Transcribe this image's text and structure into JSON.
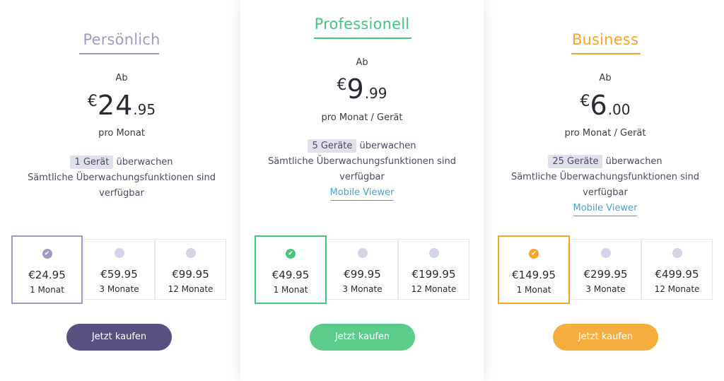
{
  "plans": [
    {
      "name": "Persönlich",
      "color": "#9b9bc4",
      "from_label": "Ab",
      "currency": "€",
      "price_int": "24",
      "price_dec": ".95",
      "per_label": "pro Monat",
      "devices_badge": "1 Gerät",
      "monitor_text": "überwachen",
      "features_text": "Sämtliche Überwachungsfunktionen sind verfügbar",
      "options": [
        {
          "price": "€24.95",
          "duration": "1 Monat",
          "selected": true
        },
        {
          "price": "€59.95",
          "duration": "3 Monate",
          "selected": false
        },
        {
          "price": "€99.95",
          "duration": "12 Monate",
          "selected": false
        }
      ],
      "buy_label": "Jetzt kaufen",
      "button_color": "#575180"
    },
    {
      "name": "Professionell",
      "color": "#46c57f",
      "from_label": "Ab",
      "currency": "€",
      "price_int": "9",
      "price_dec": ".99",
      "per_label": "pro Monat / Gerät",
      "devices_badge": "5 Geräte",
      "monitor_text": "überwachen",
      "features_text": "Sämtliche Überwachungsfunktionen sind verfügbar",
      "mobile_viewer_label": "Mobile Viewer",
      "options": [
        {
          "price": "€49.95",
          "duration": "1 Monat",
          "selected": true
        },
        {
          "price": "€99.95",
          "duration": "3 Monate",
          "selected": false
        },
        {
          "price": "€199.95",
          "duration": "12 Monate",
          "selected": false
        }
      ],
      "buy_label": "Jetzt kaufen",
      "button_color": "#5ccc8b"
    },
    {
      "name": "Business",
      "color": "#f4a62a",
      "from_label": "Ab",
      "currency": "€",
      "price_int": "6",
      "price_dec": ".00",
      "per_label": "pro Monat / Gerät",
      "devices_badge": "25 Geräte",
      "monitor_text": "überwachen",
      "features_text": "Sämtliche Überwachungsfunktionen sind verfügbar",
      "mobile_viewer_label": "Mobile Viewer",
      "options": [
        {
          "price": "€149.95",
          "duration": "1 Monat",
          "selected": true
        },
        {
          "price": "€299.95",
          "duration": "3 Monate",
          "selected": false
        },
        {
          "price": "€499.95",
          "duration": "12 Monate",
          "selected": false
        }
      ],
      "buy_label": "Jetzt kaufen",
      "button_color": "#f5ae3d"
    }
  ]
}
